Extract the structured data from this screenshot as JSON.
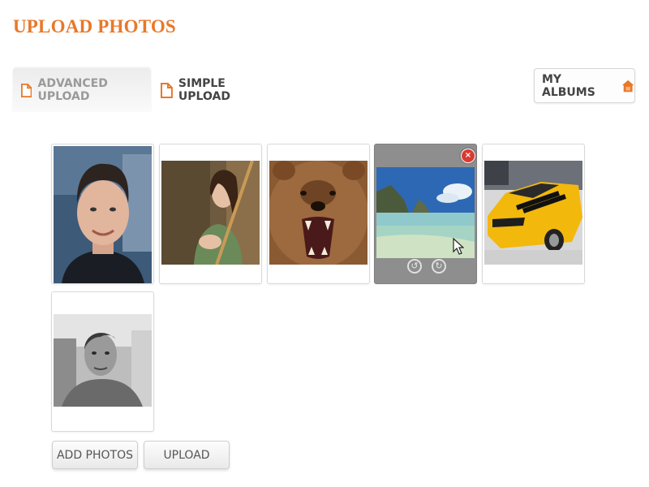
{
  "header": {
    "title": "UPLOAD PHOTOS"
  },
  "tabs": [
    {
      "label": "ADVANCED UPLOAD",
      "active": true,
      "icon": "document-icon"
    },
    {
      "label": "SIMPLE UPLOAD",
      "active": false,
      "icon": "document-icon"
    }
  ],
  "my_albums": {
    "label": "MY ALBUMS",
    "icon": "home-icon"
  },
  "photos": [
    {
      "subject": "portrait-man",
      "selected": false
    },
    {
      "subject": "woman-archer",
      "selected": false
    },
    {
      "subject": "roaring-bear",
      "selected": false
    },
    {
      "subject": "tropical-beach",
      "selected": true
    },
    {
      "subject": "yellow-sports-car",
      "selected": false
    },
    {
      "subject": "bw-portrait-man",
      "selected": false
    }
  ],
  "photo_actions": {
    "remove_symbol": "×",
    "rotate_left_symbol": "↺",
    "rotate_right_symbol": "↻"
  },
  "buttons": {
    "add_photos": "ADD PHOTOS",
    "upload": "UPLOAD"
  },
  "colors": {
    "accent": "#e8782a",
    "remove": "#d93a32",
    "selected_bg": "#8e8e8e"
  }
}
